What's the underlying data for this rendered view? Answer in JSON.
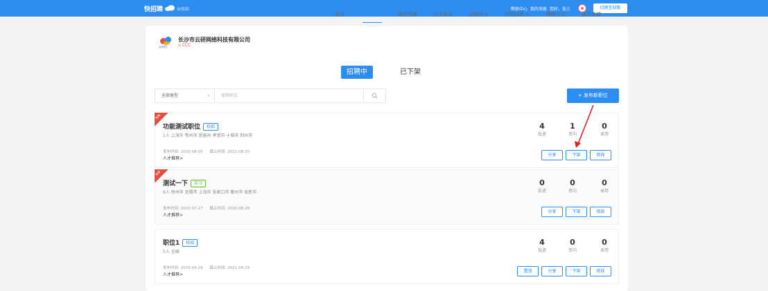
{
  "topbar": {
    "logo": "快招聘",
    "logo_sub": "云校招",
    "links": [
      "帮助中心",
      "我的消息",
      "您好，张三"
    ],
    "switch_label": "切换至旧版"
  },
  "company": {
    "name": "长沙市云研网络科技有限公司",
    "user": "CCC",
    "logo_text": "云校招"
  },
  "nav": [
    "首页",
    "职位管理",
    "简历管理",
    "人才中心",
    "云校招 ∨",
    "校园招聘 ∨",
    "网签三方",
    "道具商城"
  ],
  "tabs": {
    "active": "招聘中",
    "inactive": "已下架"
  },
  "filter": {
    "type_value": "全部类型",
    "search_placeholder": "搜索职位",
    "publish_label": "+ 发布新职位"
  },
  "jobs": [
    {
      "title": "功能测试职位",
      "tag": "校招",
      "badge": "急聘",
      "sub": "1人 上海市 鄂州市 恩施州 孝感市 十堰市 荆州市",
      "publish_time": "发布时间: 2020-08-05",
      "end_time": "截止时间: 2021-08-20",
      "recommend": "人才推荐>",
      "stats": [
        {
          "num": "4",
          "label": "投递"
        },
        {
          "num": "1",
          "label": "意向"
        },
        {
          "num": "0",
          "label": "录用"
        }
      ],
      "buttons": [
        "分享",
        "下架",
        "修改"
      ]
    },
    {
      "title": "测试一下",
      "tag": "实习",
      "badge": "急聘",
      "sub": "6人 徐州市 无锡市 上海市 张家口市 衢州市 阜新市",
      "publish_time": "发布时间: 2020-07-27",
      "end_time": "截止时间: 2020-08-28",
      "recommend": "人才推荐>",
      "stats": [
        {
          "num": "0",
          "label": "投递"
        },
        {
          "num": "0",
          "label": "意向"
        },
        {
          "num": "0",
          "label": "录用"
        }
      ],
      "buttons": [
        "分享",
        "下架",
        "修改"
      ]
    },
    {
      "title": "职位1",
      "tag": "校招",
      "sub": "5人 全国",
      "publish_time": "发布时间: 2020-04-29",
      "end_time": "截止时间: 2021-04-29",
      "recommend": "人才推荐>",
      "stats": [
        {
          "num": "4",
          "label": "投递"
        },
        {
          "num": "0",
          "label": "意向"
        },
        {
          "num": "0",
          "label": "录用"
        }
      ],
      "buttons": [
        "置顶",
        "分享",
        "下架",
        "修改"
      ]
    }
  ],
  "colors": {
    "primary": "#2d8cf0",
    "danger": "#e74c3c",
    "success": "#52c41a"
  }
}
